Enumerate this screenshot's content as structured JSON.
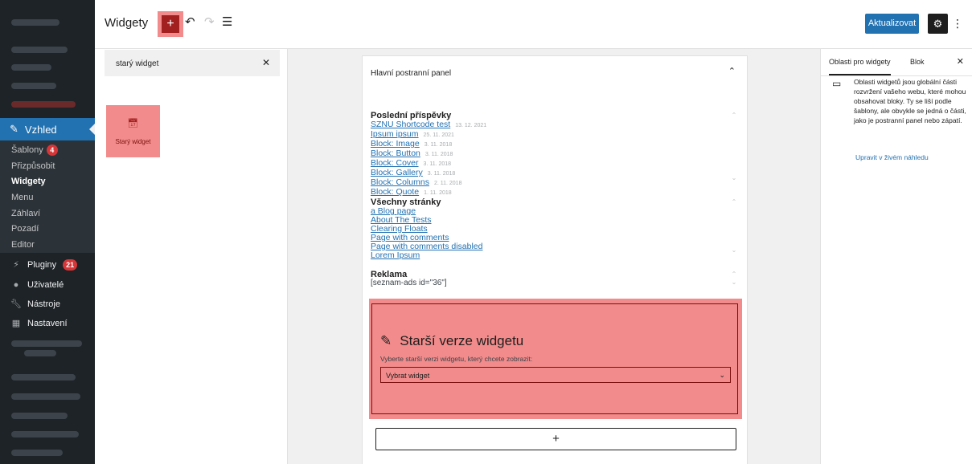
{
  "admin_menu": {
    "active_label": "Vzhled",
    "submenu": [
      {
        "label": "Šablony",
        "badge": "4"
      },
      {
        "label": "Přizpůsobit"
      },
      {
        "label": "Widgety"
      },
      {
        "label": "Menu"
      },
      {
        "label": "Záhlaví"
      },
      {
        "label": "Pozadí"
      },
      {
        "label": "Editor"
      }
    ],
    "items": [
      {
        "label": "Pluginy",
        "badge": "21",
        "icon": "plugin-icon"
      },
      {
        "label": "Uživatelé",
        "icon": "users-icon"
      },
      {
        "label": "Nástroje",
        "icon": "tools-icon"
      },
      {
        "label": "Nastavení",
        "icon": "settings-icon"
      }
    ]
  },
  "header": {
    "title": "Widgety",
    "add_symbol": "+",
    "update_label": "Aktualizovat"
  },
  "inserter": {
    "search_value": "starý widget",
    "result_label": "Starý widget"
  },
  "area": {
    "title": "Hlavní postranní panel",
    "recent_posts": {
      "title": "Poslední příspěvky",
      "posts": [
        {
          "title": "SZNU Shortcode test",
          "date": "13. 12. 2021"
        },
        {
          "title": "Ipsum ipsum",
          "date": "25. 11. 2021"
        },
        {
          "title": "Block: Image",
          "date": "3. 11. 2018"
        },
        {
          "title": "Block: Button",
          "date": "3. 11. 2018"
        },
        {
          "title": "Block: Cover",
          "date": "3. 11. 2018"
        },
        {
          "title": "Block: Gallery",
          "date": "3. 11. 2018"
        },
        {
          "title": "Block: Columns",
          "date": "2. 11. 2018"
        },
        {
          "title": "Block: Quote",
          "date": "1. 11. 2018"
        }
      ]
    },
    "pages": {
      "title": "Všechny stránky",
      "items": [
        "a Blog page",
        "About The Tests",
        "Clearing Floats",
        "Page with comments",
        "Page with comments disabled",
        "Lorem Ipsum"
      ]
    },
    "ad": {
      "title": "Reklama",
      "content": "[seznam-ads id=\"36\"]"
    },
    "legacy": {
      "title": "Starší verze widgetu",
      "label": "Vyberte starší verzi widgetu, který chcete zobrazit:",
      "select_value": "Vybrat widget"
    },
    "append_symbol": "+"
  },
  "sidebar": {
    "tab_areas": "Oblasti pro widgety",
    "tab_block": "Blok",
    "description": "Oblasti widgetů jsou globální části rozvržení vašeho webu, které mohou obsahovat bloky. Ty se liší podle šablony, ale obvykle se jedná o části, jako je postranní panel nebo zápatí.",
    "live_preview_link": "Upravit v živém náhledu"
  },
  "colors": {
    "admin_bg": "#1d2327",
    "accent": "#2271b1",
    "highlight": "#f28b8b",
    "badge": "#d63638"
  }
}
